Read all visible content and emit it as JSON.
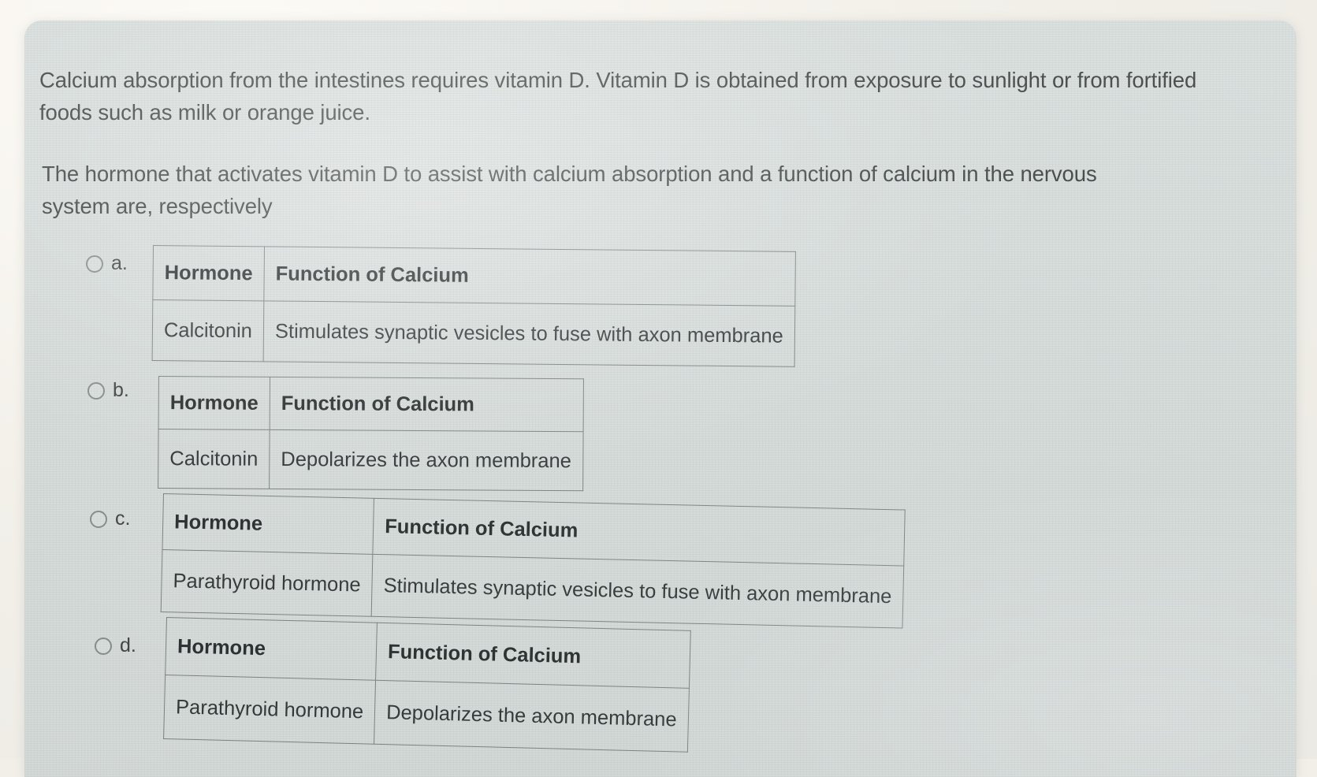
{
  "question": {
    "paragraph_1": "Calcium absorption from the intestines requires vitamin D. Vitamin D is obtained from exposure to sunlight or from fortified foods such as milk or orange juice.",
    "paragraph_2": "The hormone that activates vitamin D to assist with calcium absorption and a function of calcium in the nervous system are, respectively"
  },
  "columns": {
    "hormone": "Hormone",
    "function": "Function of Calcium"
  },
  "options": [
    {
      "letter": "a.",
      "selected": false,
      "table": {
        "headers": [
          "Hormone",
          "Function of Calcium"
        ],
        "rows": [
          [
            "Calcitonin",
            "Stimulates synaptic vesicles to fuse with axon membrane"
          ]
        ]
      }
    },
    {
      "letter": "b.",
      "selected": false,
      "table": {
        "headers": [
          "Hormone",
          "Function of Calcium"
        ],
        "rows": [
          [
            "Calcitonin",
            "Depolarizes the axon membrane"
          ]
        ]
      }
    },
    {
      "letter": "c.",
      "selected": false,
      "table": {
        "headers": [
          "Hormone",
          "Function of Calcium"
        ],
        "rows": [
          [
            "Parathyroid hormone",
            "Stimulates synaptic vesicles to fuse with axon membrane"
          ]
        ]
      }
    },
    {
      "letter": "d.",
      "selected": false,
      "table": {
        "headers": [
          "Hormone",
          "Function of Calcium"
        ],
        "rows": [
          [
            "Parathyroid hormone",
            "Depolarizes the axon membrane"
          ]
        ]
      }
    }
  ],
  "colors": {
    "card_background": "#d8dfdd",
    "page_background": "#f2efe9",
    "text": "#3c4140",
    "table_border": "#7e8786",
    "radio_border": "#8b918f"
  }
}
